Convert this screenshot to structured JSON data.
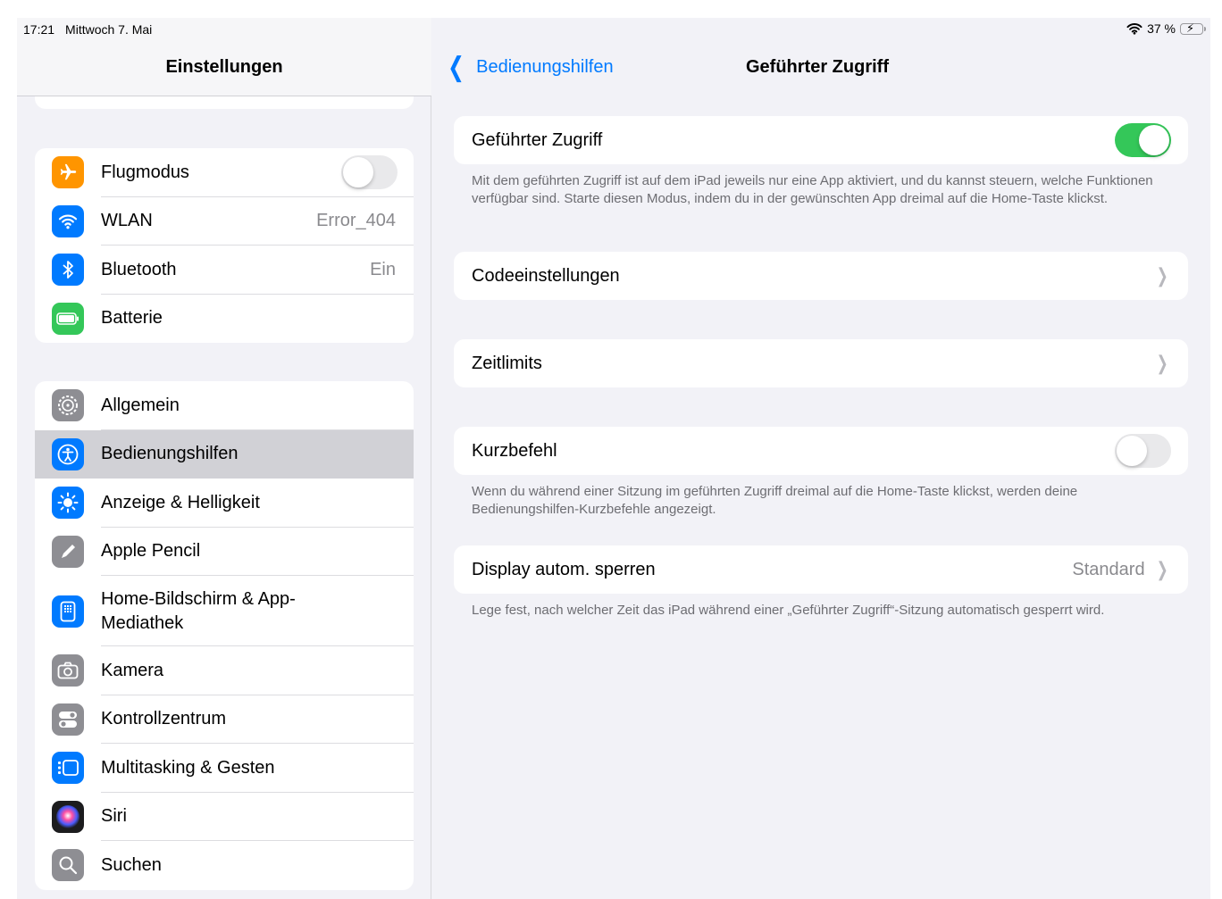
{
  "status": {
    "time": "17:21",
    "date": "Mittwoch 7. Mai",
    "battery": "37 %",
    "battery_level": 0.37
  },
  "sidebar": {
    "title": "Einstellungen",
    "group1": [
      {
        "label": "Flugmodus",
        "icon": "airplane-icon",
        "color": "#ff9500",
        "toggle": false
      },
      {
        "label": "WLAN",
        "icon": "wifi-icon",
        "color": "#007aff",
        "value": "Error_404"
      },
      {
        "label": "Bluetooth",
        "icon": "bluetooth-icon",
        "color": "#007aff",
        "value": "Ein"
      },
      {
        "label": "Batterie",
        "icon": "battery-icon",
        "color": "#34c759"
      }
    ],
    "group2": [
      {
        "label": "Allgemein",
        "icon": "gear-icon",
        "color": "#8e8e93"
      },
      {
        "label": "Bedienungshilfen",
        "icon": "accessibility-icon",
        "color": "#007aff",
        "selected": true
      },
      {
        "label": "Anzeige & Helligkeit",
        "icon": "sun-icon",
        "color": "#007aff"
      },
      {
        "label": "Apple Pencil",
        "icon": "pencil-icon",
        "color": "#8e8e93"
      },
      {
        "label": "Home-Bildschirm & App-Mediathek",
        "icon": "home-screen-icon",
        "color": "#007aff"
      },
      {
        "label": "Kamera",
        "icon": "camera-icon",
        "color": "#8e8e93"
      },
      {
        "label": "Kontrollzentrum",
        "icon": "control-center-icon",
        "color": "#8e8e93"
      },
      {
        "label": "Multitasking & Gesten",
        "icon": "multitasking-icon",
        "color": "#007aff"
      },
      {
        "label": "Siri",
        "icon": "siri-icon",
        "color": "#1c1c1e"
      },
      {
        "label": "Suchen",
        "icon": "search-icon",
        "color": "#8e8e93"
      }
    ]
  },
  "detail": {
    "back_label": "Bedienungshilfen",
    "title": "Geführter Zugriff",
    "guided_access": {
      "label": "Geführter Zugriff",
      "toggle": true,
      "note": "Mit dem geführten Zugriff ist auf dem iPad jeweils nur eine App aktiviert, und du kannst steuern, welche Funktionen verfügbar sind. Starte diesen Modus, indem du in der gewünschten App dreimal auf die Home-Taste klickst."
    },
    "passcode": {
      "label": "Codeeinstellungen"
    },
    "time_limits": {
      "label": "Zeitlimits"
    },
    "shortcut": {
      "label": "Kurzbefehl",
      "toggle": false,
      "note": "Wenn du während einer Sitzung im geführten Zugriff dreimal auf die Home-Taste klickst, werden deine Bedienungshilfen-Kurzbefehle angezeigt."
    },
    "auto_lock": {
      "label": "Display autom. sperren",
      "value": "Standard",
      "note": "Lege fest, nach welcher Zeit das iPad während einer „Geführter Zugriff“-Sitzung automatisch gesperrt wird."
    }
  }
}
